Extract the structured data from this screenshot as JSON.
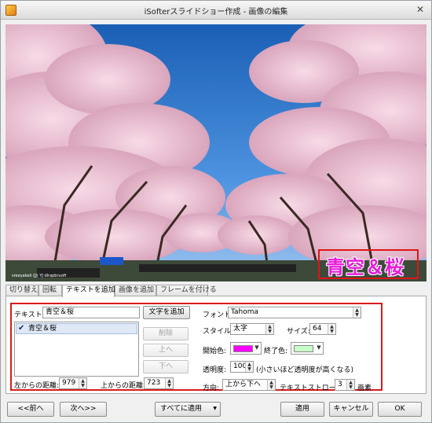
{
  "window": {
    "title": "iSofterスライドショー作成 - 画像の編集",
    "close_label": "✕"
  },
  "preview": {
    "overlay_text": "青空＆桜",
    "watermark": "sreeyakeli (JJ) YJ dlrapbruoH"
  },
  "tabs": [
    {
      "label": "切り替え"
    },
    {
      "label": "回転"
    },
    {
      "label": "テキストを追加"
    },
    {
      "label": "画像を追加"
    },
    {
      "label": "フレームを付ける"
    }
  ],
  "text_panel": {
    "text_label": "テキスト:",
    "text_value": "青空＆桜",
    "add_text_button": "文字を追加",
    "list_items": [
      "青空＆桜"
    ],
    "delete_button": "削除",
    "up_button": "上へ",
    "down_button": "下へ",
    "left_distance_label": "左からの距離:",
    "left_distance_value": "979",
    "top_distance_label": "上からの距離:",
    "top_distance_value": "723",
    "font_label": "フォント:",
    "font_value": "Tahoma",
    "style_label": "スタイル:",
    "style_value": "太字",
    "size_label": "サイズ:",
    "size_value": "64",
    "start_color_label": "開始色:",
    "start_color": "#ff00ff",
    "end_color_label": "終了色:",
    "end_color": "#c8ffc8",
    "opacity_label": "透明度:",
    "opacity_value": "100",
    "opacity_hint": "(小さいほど透明度が高くなる)",
    "direction_label": "方向:",
    "direction_value": "上から下へ",
    "stroke_label": "テキストストローク:",
    "stroke_value": "3",
    "stroke_unit": "画素"
  },
  "footer": {
    "prev_button": "<<前へ",
    "next_button": "次へ>>",
    "apply_all_button": "すべてに適用",
    "apply_button": "適用",
    "cancel_button": "キャンセル",
    "ok_button": "OK"
  },
  "colors": {
    "highlight_frame": "#d91a1a",
    "overlay_text": "#e81bd8"
  }
}
